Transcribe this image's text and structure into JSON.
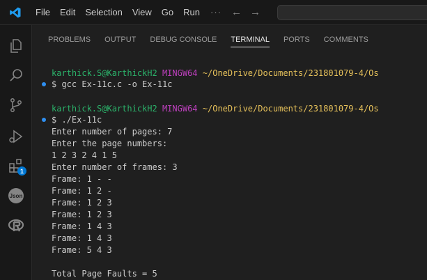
{
  "titlebar": {
    "menu": [
      "File",
      "Edit",
      "Selection",
      "View",
      "Go",
      "Run"
    ],
    "more": "···",
    "back_arrow": "←",
    "forward_arrow": "→"
  },
  "activitybar": {
    "items": [
      "explorer-icon",
      "search-icon",
      "source-control-icon",
      "run-debug-icon",
      "extensions-icon",
      "json-icon",
      "r-icon"
    ],
    "extensions_badge": "1",
    "json_label": "Json"
  },
  "panel": {
    "tabs": [
      "PROBLEMS",
      "OUTPUT",
      "DEBUG CONSOLE",
      "TERMINAL",
      "PORTS",
      "COMMENTS"
    ],
    "active_tab": "TERMINAL"
  },
  "terminal": {
    "prompt1": {
      "user": "karthick.S@KarthickH2",
      "host": "MINGW64",
      "path": "~/OneDrive/Documents/231801079-4/Os"
    },
    "cmd1": "$ gcc Ex-11c.c -o Ex-11c",
    "prompt2": {
      "user": "karthick.S@KarthickH2",
      "host": "MINGW64",
      "path": "~/OneDrive/Documents/231801079-4/Os"
    },
    "cmd2": "$ ./Ex-11c",
    "output": [
      "Enter number of pages: 7",
      "Enter the page numbers:",
      "1 2 3 2 4 1 5",
      "Enter number of frames: 3",
      "Frame: 1 - -",
      "Frame: 1 2 -",
      "Frame: 1 2 3",
      "Frame: 1 2 3",
      "Frame: 1 4 3",
      "Frame: 1 4 3",
      "Frame: 5 4 3"
    ],
    "summary": "Total Page Faults = 5"
  },
  "colors": {
    "user": "#2bb26a",
    "host": "#bc3fbc",
    "path": "#e5c05a",
    "marker": "#2f8ff0",
    "badge": "#0078d4"
  }
}
